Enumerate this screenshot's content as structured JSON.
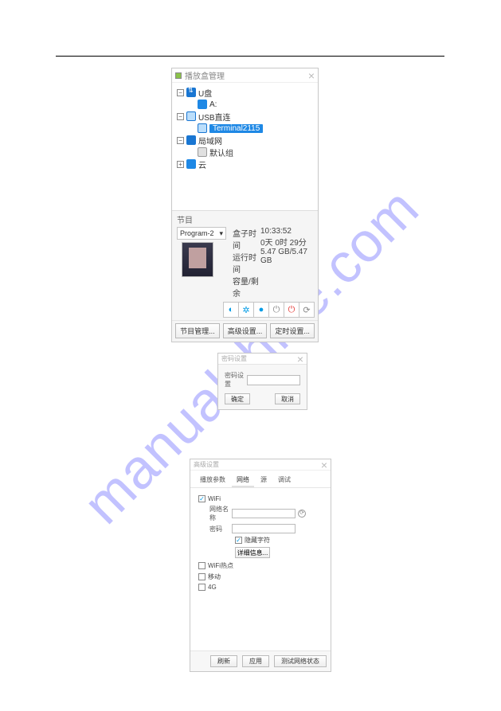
{
  "watermark": "manualshive.com",
  "win1": {
    "title": "播放盒管理",
    "tree": {
      "usb_root": "U盘",
      "drive_a": "A:",
      "usb_direct": "USB直连",
      "terminal": "Terminal2115",
      "lan": "局域网",
      "default_group": "默认组",
      "cloud": "云"
    },
    "section": "节目",
    "program": "Program-2",
    "labels": {
      "box_time": "盒子时间",
      "run_time": "运行时间",
      "capacity": "容量/剩余"
    },
    "values": {
      "box_time": "10:33:52",
      "run_time": "0天 0时 29分",
      "capacity": "5.47 GB/5.47 GB"
    },
    "buttons": {
      "program_mgmt": "节目管理...",
      "advanced": "高级设置...",
      "timer": "定时设置..."
    }
  },
  "win2": {
    "title": "密码设置",
    "field_label": "密码设置",
    "ok": "确定",
    "cancel": "取消"
  },
  "win3": {
    "title": "高级设置",
    "tabs": [
      "播放参数",
      "网络",
      "源",
      "调试"
    ],
    "wifi": "WiFi",
    "net_name": "网络名称",
    "password": "密码",
    "hide_chars": "隐藏字符",
    "detail": "详细信息...",
    "wifi_hotspot": "WiFi热点",
    "mobile": "移动",
    "fourg": "4G",
    "footer": {
      "refresh": "刷新",
      "apply": "应用",
      "test": "测试网络状态"
    }
  }
}
